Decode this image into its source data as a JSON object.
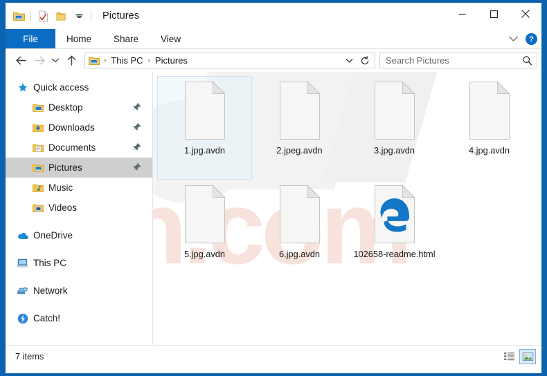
{
  "window": {
    "title": "Pictures",
    "accent_color": "#0b6cc4",
    "frame_color": "#0b63ad",
    "quick_access": [
      {
        "name": "pictures-folder-icon",
        "label": "Pictures folder properties"
      },
      {
        "name": "properties-icon",
        "label": "Properties"
      },
      {
        "name": "new-folder-icon",
        "label": "New folder"
      },
      {
        "name": "customize-qat-icon",
        "label": "Customize Quick Access Toolbar"
      }
    ],
    "controls": {
      "minimize": "Minimize",
      "maximize": "Maximize",
      "close": "Close"
    }
  },
  "ribbon": {
    "tabs": [
      {
        "label": "File",
        "active": true
      },
      {
        "label": "Home",
        "active": false
      },
      {
        "label": "Share",
        "active": false
      },
      {
        "label": "View",
        "active": false
      }
    ],
    "expand_label": "Expand the Ribbon",
    "help_label": "?"
  },
  "navigation": {
    "back": "Back",
    "forward": "Forward",
    "recent": "Recent locations",
    "up": "Up",
    "breadcrumbs": [
      "This PC",
      "Pictures"
    ],
    "breadcrumb_separator": "›",
    "address_dropdown": "Previous locations",
    "refresh": "Refresh"
  },
  "search": {
    "placeholder": "Search Pictures",
    "value": ""
  },
  "sidebar": {
    "items": [
      {
        "label": "Quick access",
        "icon": "star-icon",
        "indent": false,
        "pinned": false,
        "selected": false
      },
      {
        "label": "Desktop",
        "icon": "desktop-folder-icon",
        "indent": true,
        "pinned": true,
        "selected": false
      },
      {
        "label": "Downloads",
        "icon": "downloads-folder-icon",
        "indent": true,
        "pinned": true,
        "selected": false
      },
      {
        "label": "Documents",
        "icon": "documents-folder-icon",
        "indent": true,
        "pinned": true,
        "selected": false
      },
      {
        "label": "Pictures",
        "icon": "pictures-folder-icon",
        "indent": true,
        "pinned": true,
        "selected": true
      },
      {
        "label": "Music",
        "icon": "music-folder-icon",
        "indent": true,
        "pinned": false,
        "selected": false
      },
      {
        "label": "Videos",
        "icon": "videos-folder-icon",
        "indent": true,
        "pinned": false,
        "selected": false
      },
      {
        "label": "OneDrive",
        "icon": "onedrive-cloud-icon",
        "indent": false,
        "pinned": false,
        "selected": false,
        "gap_before": true
      },
      {
        "label": "This PC",
        "icon": "this-pc-icon",
        "indent": false,
        "pinned": false,
        "selected": false,
        "gap_before": true
      },
      {
        "label": "Network",
        "icon": "network-icon",
        "indent": false,
        "pinned": false,
        "selected": false,
        "gap_before": true
      },
      {
        "label": "Catch!",
        "icon": "catch-icon",
        "indent": false,
        "pinned": false,
        "selected": false,
        "gap_before": true
      }
    ]
  },
  "files": [
    {
      "name": "1.jpg.avdn",
      "icon": "blank-file-icon",
      "selected": true
    },
    {
      "name": "2.jpeg.avdn",
      "icon": "blank-file-icon",
      "selected": false
    },
    {
      "name": "3.jpg.avdn",
      "icon": "blank-file-icon",
      "selected": false
    },
    {
      "name": "4.jpg.avdn",
      "icon": "blank-file-icon",
      "selected": false
    },
    {
      "name": "5.jpg.avdn",
      "icon": "blank-file-icon",
      "selected": false
    },
    {
      "name": "6.jpg.avdn",
      "icon": "blank-file-icon",
      "selected": false
    },
    {
      "name": "102658-readme.html",
      "icon": "edge-html-file-icon",
      "selected": false
    }
  ],
  "status": {
    "items_text": "7 items",
    "view_details": "Details view",
    "view_large_icons": "Large icons view"
  },
  "watermark": {
    "text": "sh.com",
    "color": "#f7e3dc"
  }
}
